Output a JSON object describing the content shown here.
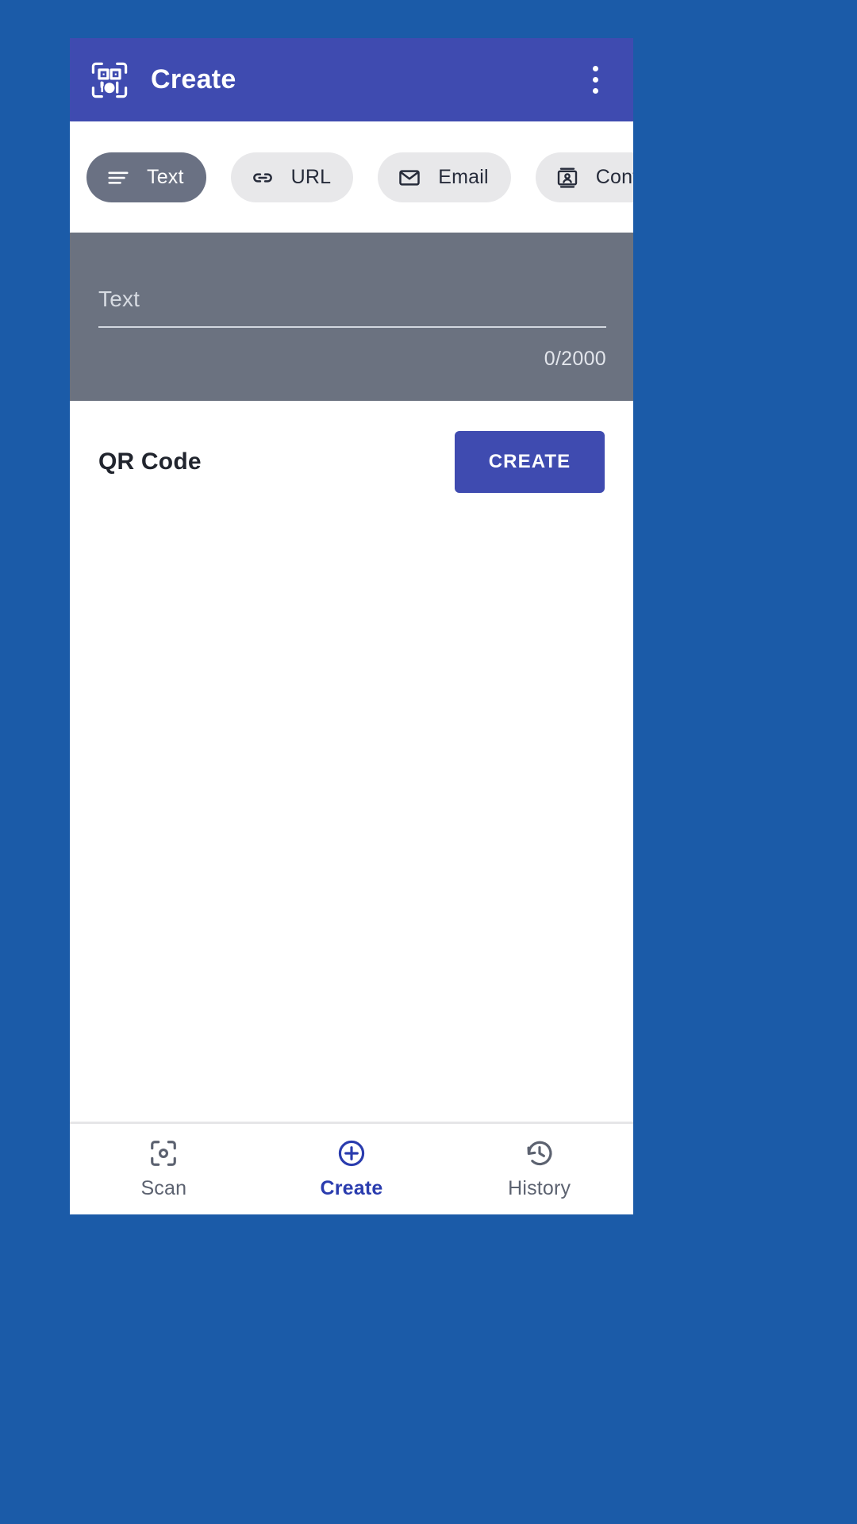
{
  "window": {
    "background_color": "#1B5BA8",
    "screen_background": "#FFFFFF"
  },
  "appbar": {
    "title": "Create",
    "logo_icon": "qr-food-scan-icon",
    "overflow_icon": "more-vert-icon",
    "background_color": "#3F4BB0",
    "title_color": "#FFFFFF"
  },
  "type_chips": {
    "selected_index": 0,
    "selected_color": "#6A7183",
    "unselected_color": "#E8E8EA",
    "items": [
      {
        "label": "Text",
        "icon": "subject-lines-icon",
        "selected": true
      },
      {
        "label": "URL",
        "icon": "link-icon",
        "selected": false
      },
      {
        "label": "Email",
        "icon": "envelope-icon",
        "selected": false
      },
      {
        "label": "Contact",
        "icon": "contact-card-icon",
        "selected": false
      }
    ]
  },
  "input_panel": {
    "background_color": "#6B7280",
    "placeholder": "Text",
    "value": "",
    "counter": "0/2000",
    "max_length": 2000
  },
  "result": {
    "title": "QR Code",
    "create_label": "CREATE",
    "create_button_color": "#3F4BB0"
  },
  "bottom_nav": {
    "active_index": 1,
    "active_color": "#2A3CAE",
    "inactive_color": "#5C6270",
    "items": [
      {
        "label": "Scan",
        "icon": "scan-frame-icon",
        "active": false
      },
      {
        "label": "Create",
        "icon": "plus-circle-icon",
        "active": true
      },
      {
        "label": "History",
        "icon": "history-clock-icon",
        "active": false
      }
    ]
  }
}
